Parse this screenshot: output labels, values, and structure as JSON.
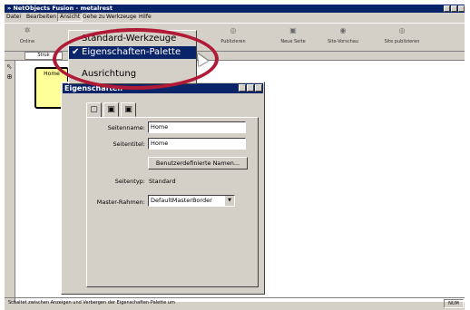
{
  "window": {
    "title": "» NetObjects Fusion - metalrest"
  },
  "menubar": {
    "items": [
      "Datei",
      "Bearbeiten",
      "Ansicht",
      "Gehe zu",
      "Werkzeuge",
      "Hilfe"
    ]
  },
  "toolbar": {
    "buttons": [
      {
        "label": "Online",
        "icon": "globe-icon"
      },
      {
        "label": "Publizieren",
        "icon": "publish-icon"
      },
      {
        "label": "Neue Seite",
        "icon": "new-page-icon"
      },
      {
        "label": "Site-Vorschau",
        "icon": "preview-icon"
      },
      {
        "label": "Site publizieren",
        "icon": "site-publish-icon"
      }
    ],
    "mode_tab": "Struk"
  },
  "view_menu": {
    "items": [
      {
        "label": "Standard-Werkzeuge",
        "checked": false
      },
      {
        "label": "Eigenschaften-Palette",
        "checked": true
      },
      {
        "label": "Ausrichtung",
        "checked": false
      }
    ]
  },
  "site_page": {
    "label": "Home"
  },
  "properties": {
    "title": "Eigenschaften",
    "fields": {
      "seitenname_label": "Seitenname:",
      "seitenname_value": "Home",
      "seitentitel_label": "Seitentitel:",
      "seitentitel_value": "Home",
      "custom_names_button": "Benutzerdefinierte Namen...",
      "seitentyp_label": "Seitentyp:",
      "seitentyp_value": "Standard",
      "master_label": "Master-Rahmen:",
      "master_value": "DefaultMasterBorder"
    }
  },
  "status": {
    "message": "Schaltet zwischen Anzeigen und Verbergen der Eigenschaften-Palette um",
    "pane": "NUM"
  },
  "colors": {
    "titlebar": "#0a246a",
    "highlight_ring": "#b01a36",
    "page_fill": "#ffff99"
  }
}
